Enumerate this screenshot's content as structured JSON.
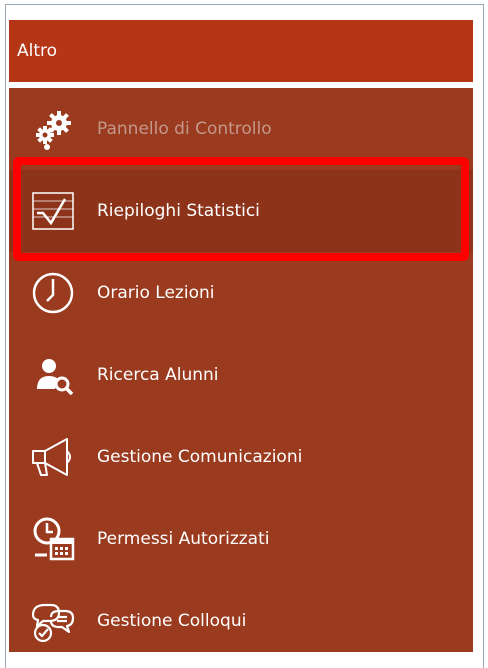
{
  "section": {
    "title": "Altro"
  },
  "menu": {
    "items": [
      {
        "label": "Pannello di Controllo",
        "icon": "gears-icon",
        "disabled": true
      },
      {
        "label": "Riepiloghi Statistici",
        "icon": "chart-icon",
        "selected": true
      },
      {
        "label": "Orario Lezioni",
        "icon": "clock-icon"
      },
      {
        "label": "Ricerca Alunni",
        "icon": "user-search-icon"
      },
      {
        "label": "Gestione Comunicazioni",
        "icon": "megaphone-icon"
      },
      {
        "label": "Permessi Autorizzati",
        "icon": "clock-calendar-icon"
      },
      {
        "label": "Gestione Colloqui",
        "icon": "chat-bubbles-icon"
      }
    ]
  },
  "colors": {
    "header_bg": "#b53517",
    "menu_bg": "#9a3a1e",
    "highlight": "#ff0000",
    "disabled_text": "#c4988c"
  }
}
